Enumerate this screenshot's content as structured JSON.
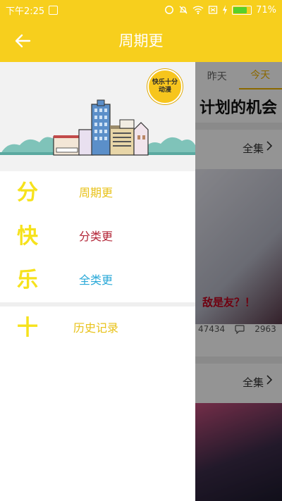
{
  "status_bar": {
    "time": "下午2:25",
    "battery": "71%",
    "battery_level": 0.71
  },
  "app_bar": {
    "title": "周期更",
    "back_icon": "back-arrow-icon"
  },
  "drawer": {
    "logo_line1": "快乐十分",
    "logo_line2": "动漫",
    "items": [
      {
        "glyph": "分",
        "label": "周期更",
        "color": "#e8c21a"
      },
      {
        "glyph": "快",
        "label": "分类更",
        "color": "#b22436"
      },
      {
        "glyph": "乐",
        "label": "全类更",
        "color": "#2aa9d8"
      },
      {
        "glyph": "十",
        "label": "历史记录",
        "color": "#e8c21a"
      }
    ]
  },
  "background": {
    "tabs": [
      "昨天",
      "今天"
    ],
    "banner_text": "计划的机会",
    "all_label": "全集",
    "caption": "敌是友？！",
    "likes": "47434",
    "comments": "2963"
  }
}
